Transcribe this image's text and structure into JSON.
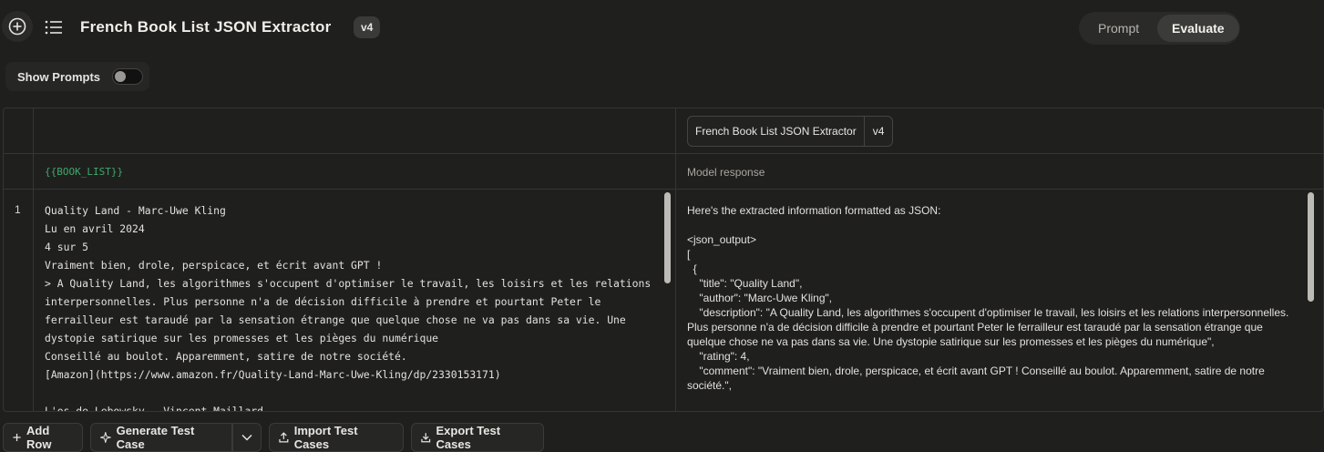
{
  "header": {
    "title": "French Book List JSON Extractor",
    "version": "v4",
    "tabs": [
      {
        "label": "Prompt",
        "active": false
      },
      {
        "label": "Evaluate",
        "active": true
      }
    ]
  },
  "show_prompts": {
    "label": "Show Prompts",
    "enabled": false
  },
  "table": {
    "prompt_chip": {
      "name": "French Book List JSON Extractor",
      "version": "v4"
    },
    "variable_label": "{{BOOK_LIST}}",
    "response_label": "Model response",
    "rows": [
      {
        "number": "1",
        "input": "Quality Land - Marc-Uwe Kling\nLu en avril 2024\n4 sur 5\nVraiment bien, drole, perspicace, et écrit avant GPT !\n> A Quality Land, les algorithmes s'occupent d'optimiser le travail, les loisirs et les relations interpersonnelles. Plus personne n'a de décision difficile à prendre et pourtant Peter le ferrailleur est taraudé par la sensation étrange que quelque chose ne va pas dans sa vie. Une dystopie satirique sur les promesses et les pièges du numérique\nConseillé au boulot. Apparemment, satire de notre société.\n[Amazon](https://www.amazon.fr/Quality-Land-Marc-Uwe-Kling/dp/2330153171)\n\nL'os de Lebowsky - Vincent Maillard",
        "output": "Here's the extracted information formatted as JSON:\n\n<json_output>\n[\n  {\n    \"title\": \"Quality Land\",\n    \"author\": \"Marc-Uwe Kling\",\n    \"description\": \"A Quality Land, les algorithmes s'occupent d'optimiser le travail, les loisirs et les relations interpersonnelles. Plus personne n'a de décision difficile à prendre et pourtant Peter le ferrailleur est taraudé par la sensation étrange que quelque chose ne va pas dans sa vie. Une dystopie satirique sur les promesses et les pièges du numérique\",\n    \"rating\": 4,\n    \"comment\": \"Vraiment bien, drole, perspicace, et écrit avant GPT ! Conseillé au boulot. Apparemment, satire de notre société.\","
      }
    ]
  },
  "actions": {
    "add_row": "Add Row",
    "generate": "Generate Test Case",
    "import": "Import Test Cases",
    "export": "Export Test Cases"
  },
  "icons": {
    "new": "plus-circle-icon",
    "list": "list-icon",
    "plus": "plus-icon",
    "sparkle": "sparkle-icon",
    "chevron": "chevron-down-icon",
    "upload": "upload-icon",
    "download": "download-icon"
  }
}
